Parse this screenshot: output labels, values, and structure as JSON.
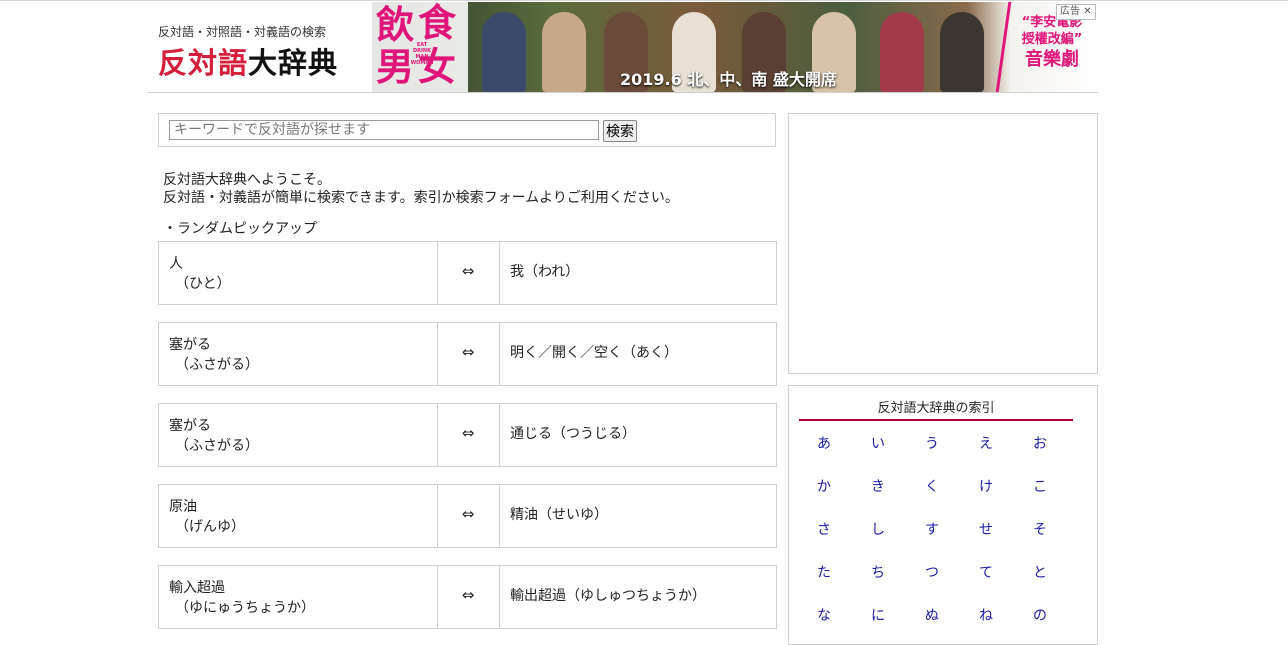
{
  "header": {
    "subtitle": "反対語・対照語・対義語の検索",
    "title_red": "反対語",
    "title_black": "大辞典"
  },
  "ad": {
    "logo_chars": [
      "飲",
      "食",
      "男",
      "女"
    ],
    "logo_english": "EAT DRINK MAN WOMAN",
    "date_text": "2019.6  北、中、南 盛大開席",
    "slogan_line1": "“李安電影",
    "slogan_line2": "授權改編”",
    "slogan_line3": "音樂劇",
    "label": "広告",
    "close": "✕"
  },
  "search": {
    "placeholder": "キーワードで反対語が探せます",
    "button_label": "検索"
  },
  "intro": {
    "line1": "反対語大辞典へようこそ。",
    "line2": "反対語・対義語が簡単に検索できます。索引か検索フォームよりご利用ください。"
  },
  "pickup": {
    "title": "・ランダムピックアップ",
    "arrow": "⇔",
    "pairs": [
      {
        "word": "人",
        "reading": "（ひと）",
        "opposite": "我（われ）"
      },
      {
        "word": "塞がる",
        "reading": "（ふさがる）",
        "opposite": "明く／開く／空く（あく）"
      },
      {
        "word": "塞がる",
        "reading": "（ふさがる）",
        "opposite": "通じる（つうじる）"
      },
      {
        "word": "原油",
        "reading": "（げんゆ）",
        "opposite": "精油（せいゆ）"
      },
      {
        "word": "輸入超過",
        "reading": "（ゆにゅうちょうか）",
        "opposite": "輸出超過（ゆしゅつちょうか）"
      }
    ]
  },
  "index": {
    "title": "反対語大辞典の索引",
    "rows": [
      [
        "あ",
        "い",
        "う",
        "え",
        "お"
      ],
      [
        "か",
        "き",
        "く",
        "け",
        "こ"
      ],
      [
        "さ",
        "し",
        "す",
        "せ",
        "そ"
      ],
      [
        "た",
        "ち",
        "つ",
        "て",
        "と"
      ],
      [
        "な",
        "に",
        "ぬ",
        "ね",
        "の"
      ]
    ]
  },
  "colors": {
    "accent_red": "#d41e3c",
    "index_rule": "#b0003a",
    "link_blue": "#1a1aa6",
    "ad_pink": "#e0157a"
  }
}
